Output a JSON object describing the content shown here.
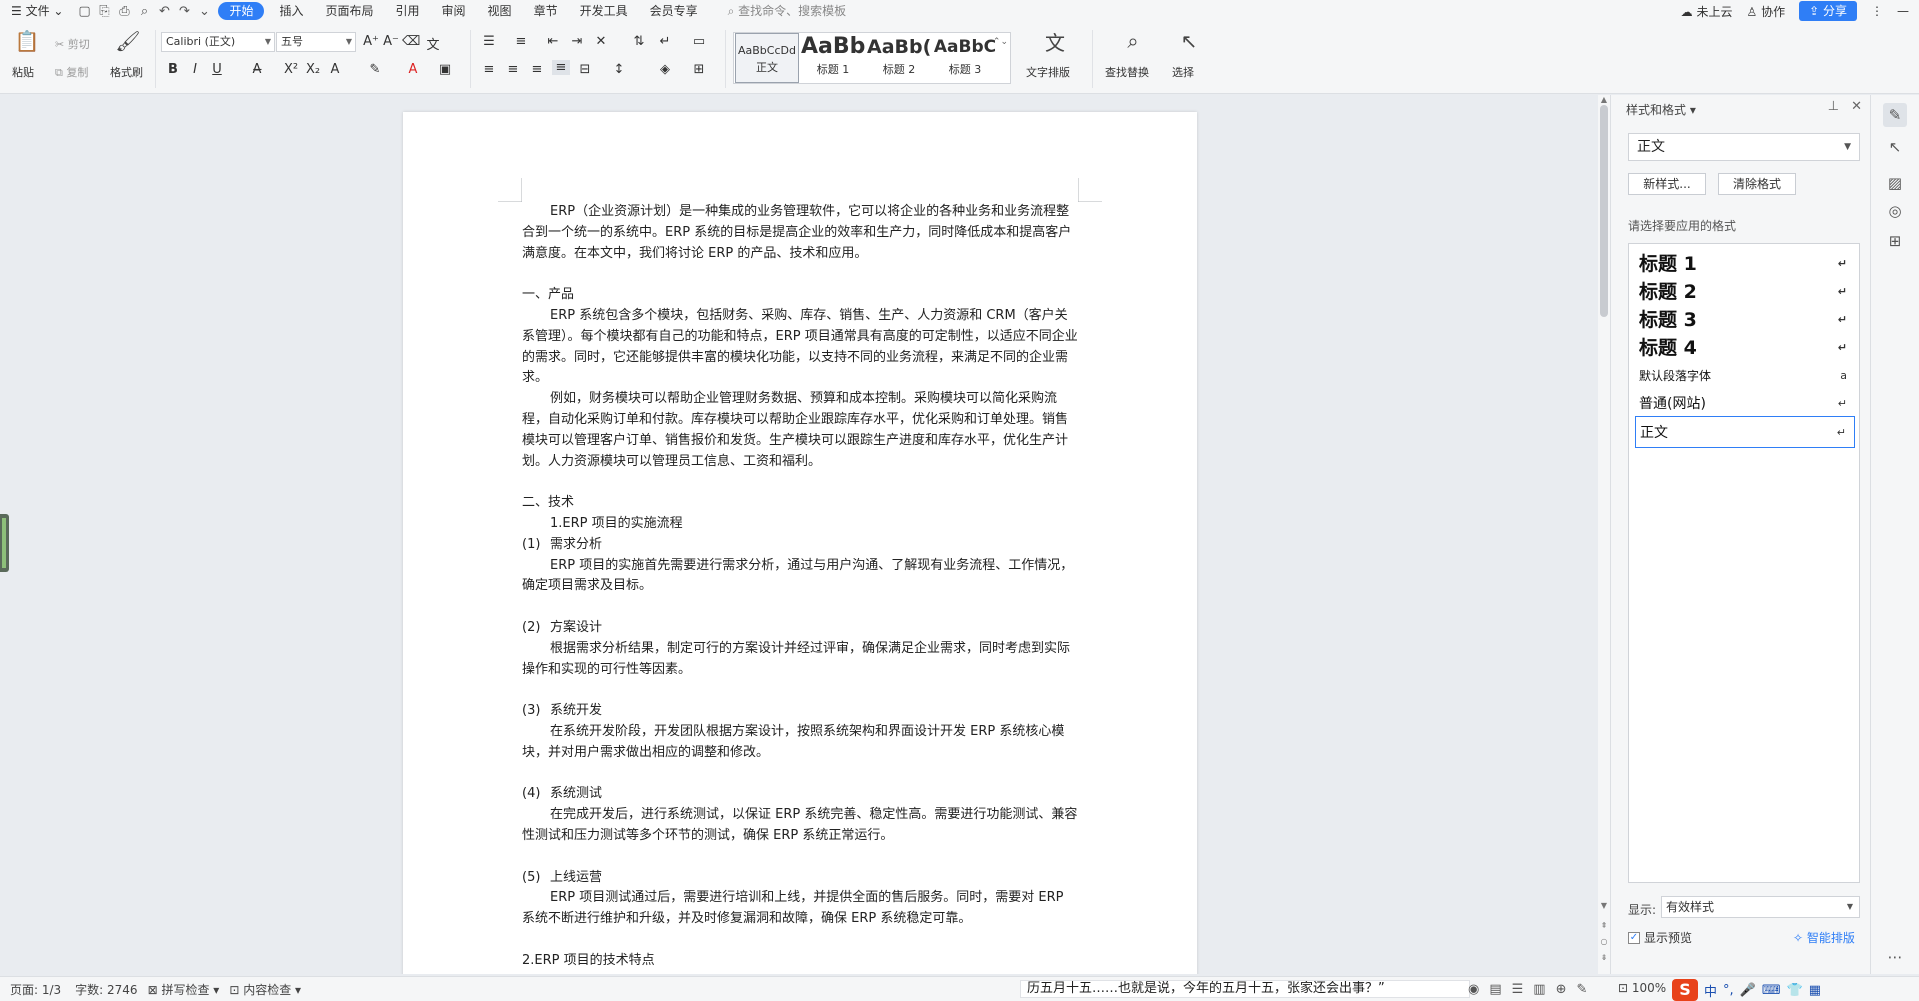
{
  "menubar": {
    "file": "文件",
    "tabs": [
      "开始",
      "插入",
      "页面布局",
      "引用",
      "审阅",
      "视图",
      "章节",
      "开发工具",
      "会员专享"
    ],
    "active_tab": "开始",
    "search_placeholder": "查找命令、搜索模板",
    "cloud": "未上云",
    "collab": "协作",
    "share": "分享"
  },
  "ribbon": {
    "paste": "粘贴",
    "cut": "剪切",
    "copy": "复制",
    "format_painter": "格式刷",
    "font_name": "Calibri (正文)",
    "font_size": "五号",
    "styles": [
      {
        "preview": "AaBbCcDd",
        "name": "正文"
      },
      {
        "preview": "AaBb",
        "name": "标题 1"
      },
      {
        "preview": "AaBb(",
        "name": "标题 2"
      },
      {
        "preview": "AaBbC",
        "name": "标题 3"
      }
    ],
    "text_layout": "文字排版",
    "find_replace": "查找替换",
    "select": "选择"
  },
  "document": {
    "paragraphs": [
      {
        "type": "ind",
        "text": "ERP（企业资源计划）是一种集成的业务管理软件，它可以将企业的各种业务和业务流程整合到一个统一的系统中。ERP 系统的目标是提高企业的效率和生产力，同时降低成本和提高客户满意度。在本文中，我们将讨论 ERP 的产品、技术和应用。"
      },
      {
        "type": "blank",
        "text": ""
      },
      {
        "type": "plain",
        "text": "一、产品"
      },
      {
        "type": "ind",
        "text": "ERP 系统包含多个模块，包括财务、采购、库存、销售、生产、人力资源和 CRM（客户关系管理）。每个模块都有自己的功能和特点，ERP 项目通常具有高度的可定制性，以适应不同企业的需求。同时，它还能够提供丰富的模块化功能，以支持不同的业务流程，来满足不同的企业需求。"
      },
      {
        "type": "ind",
        "text": "例如，财务模块可以帮助企业管理财务数据、预算和成本控制。采购模块可以简化采购流程，自动化采购订单和付款。库存模块可以帮助企业跟踪库存水平，优化采购和订单处理。销售模块可以管理客户订单、销售报价和发货。生产模块可以跟踪生产进度和库存水平，优化生产计划。人力资源模块可以管理员工信息、工资和福利。"
      },
      {
        "type": "blank",
        "text": ""
      },
      {
        "type": "plain",
        "text": "二、技术"
      },
      {
        "type": "sub",
        "text": "1.ERP  项目的实施流程"
      },
      {
        "type": "num",
        "num": "(1)",
        "text": "需求分析"
      },
      {
        "type": "ind",
        "text": "ERP 项目的实施首先需要进行需求分析，通过与用户沟通、了解现有业务流程、工作情况，确定项目需求及目标。"
      },
      {
        "type": "blank",
        "text": ""
      },
      {
        "type": "num",
        "num": "(2)",
        "text": "方案设计"
      },
      {
        "type": "ind",
        "text": "根据需求分析结果，制定可行的方案设计并经过评审，确保满足企业需求，同时考虑到实际操作和实现的可行性等因素。"
      },
      {
        "type": "blank",
        "text": ""
      },
      {
        "type": "num",
        "num": "(3)",
        "text": "系统开发"
      },
      {
        "type": "ind",
        "text": "在系统开发阶段，开发团队根据方案设计，按照系统架构和界面设计开发 ERP 系统核心模块，并对用户需求做出相应的调整和修改。"
      },
      {
        "type": "blank",
        "text": ""
      },
      {
        "type": "num",
        "num": "(4)",
        "text": "系统测试"
      },
      {
        "type": "ind",
        "text": "在完成开发后，进行系统测试，以保证 ERP 系统完善、稳定性高。需要进行功能测试、兼容性测试和压力测试等多个环节的测试，确保  ERP  系统正常运行。"
      },
      {
        "type": "blank",
        "text": ""
      },
      {
        "type": "num",
        "num": "(5)",
        "text": "上线运营"
      },
      {
        "type": "ind",
        "text": "ERP 项目测试通过后，需要进行培训和上线，并提供全面的售后服务。同时，需要对 ERP 系统不断进行维护和升级，并及时修复漏洞和故障，确保 ERP 系统稳定可靠。"
      },
      {
        "type": "blank",
        "text": ""
      },
      {
        "type": "plain",
        "text": "2.ERP  项目的技术特点"
      }
    ]
  },
  "panel": {
    "title": "样式和格式",
    "current_style": "正文",
    "new_style": "新样式...",
    "clear_format": "清除格式",
    "apply_label": "请选择要应用的格式",
    "items": [
      {
        "label": "标题  1",
        "kind": "h",
        "mark": "↵"
      },
      {
        "label": "标题  2",
        "kind": "h",
        "mark": "↵"
      },
      {
        "label": "标题  3",
        "kind": "h",
        "mark": "↵"
      },
      {
        "label": "标题  4",
        "kind": "h",
        "mark": "↵"
      },
      {
        "label": "默认段落字体",
        "kind": "s",
        "mark": "a"
      },
      {
        "label": "普通(网站)",
        "kind": "n",
        "mark": "↵"
      },
      {
        "label": "正文",
        "kind": "n",
        "mark": "↵"
      }
    ],
    "show_label": "显示:",
    "show_value": "有效样式",
    "preview_label": "显示预览",
    "smart_layout": "智能排版"
  },
  "status": {
    "page": "页面: 1/3",
    "words": "字数: 2746",
    "spell": "拼写检查",
    "content": "内容检查",
    "marquee": "历五月十五……也就是说，今年的五月十五，张家还会出事？”",
    "zoom": "100%",
    "ime": "中"
  }
}
